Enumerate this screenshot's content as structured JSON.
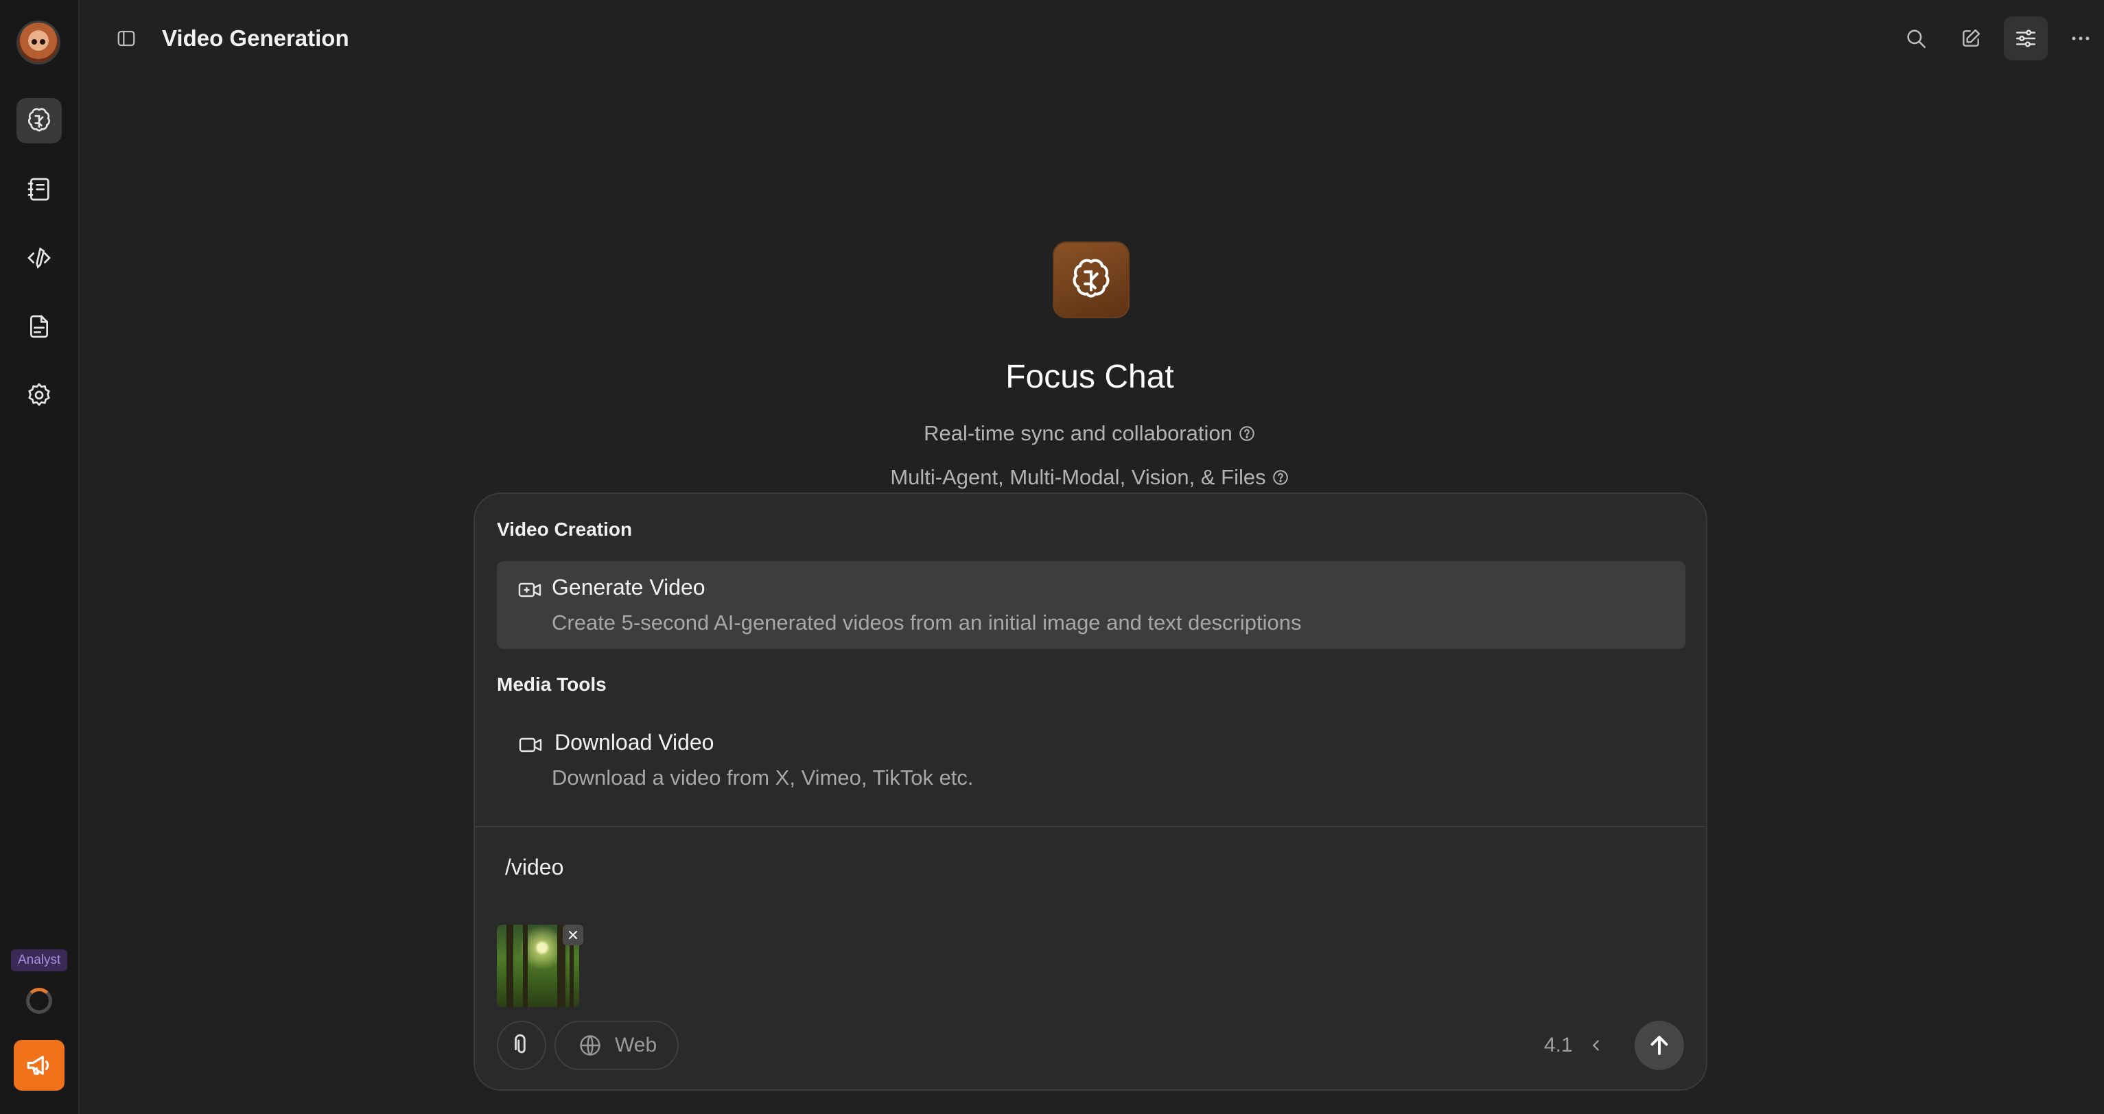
{
  "sidebar": {
    "analyst_badge": "Analyst",
    "items": [
      {
        "name": "brain-icon",
        "active": true
      },
      {
        "name": "notebook-icon",
        "active": false
      },
      {
        "name": "code-pen-icon",
        "active": false
      },
      {
        "name": "document-icon",
        "active": false
      },
      {
        "name": "settings-icon",
        "active": false
      }
    ],
    "announce_color": "#f0731c"
  },
  "header": {
    "title": "Video Generation",
    "actions": [
      "search-icon",
      "edit-icon",
      "sliders-icon",
      "more-icon"
    ]
  },
  "hero": {
    "app_name": "Focus Chat",
    "line1": "Real-time sync and collaboration",
    "line2": "Multi-Agent, Multi-Modal, Vision, & Files"
  },
  "command_panel": {
    "sections": [
      {
        "label": "Video Creation",
        "items": [
          {
            "title": "Generate Video",
            "description": "Create 5-second AI-generated videos from an initial image and text descriptions",
            "icon": "video-plus-icon",
            "highlighted": true
          }
        ]
      },
      {
        "label": "Media Tools",
        "items": [
          {
            "title": "Download Video",
            "description": "Download a video from X, Vimeo, TikTok etc.",
            "icon": "video-camera-icon",
            "highlighted": false
          }
        ]
      }
    ]
  },
  "composer": {
    "input_value": "/video",
    "web_label": "Web",
    "model_version": "4.1"
  },
  "colors": {
    "background": "#212121",
    "sidebar": "#181818",
    "panel": "#2a2a2a",
    "accent": "#f0731c"
  }
}
